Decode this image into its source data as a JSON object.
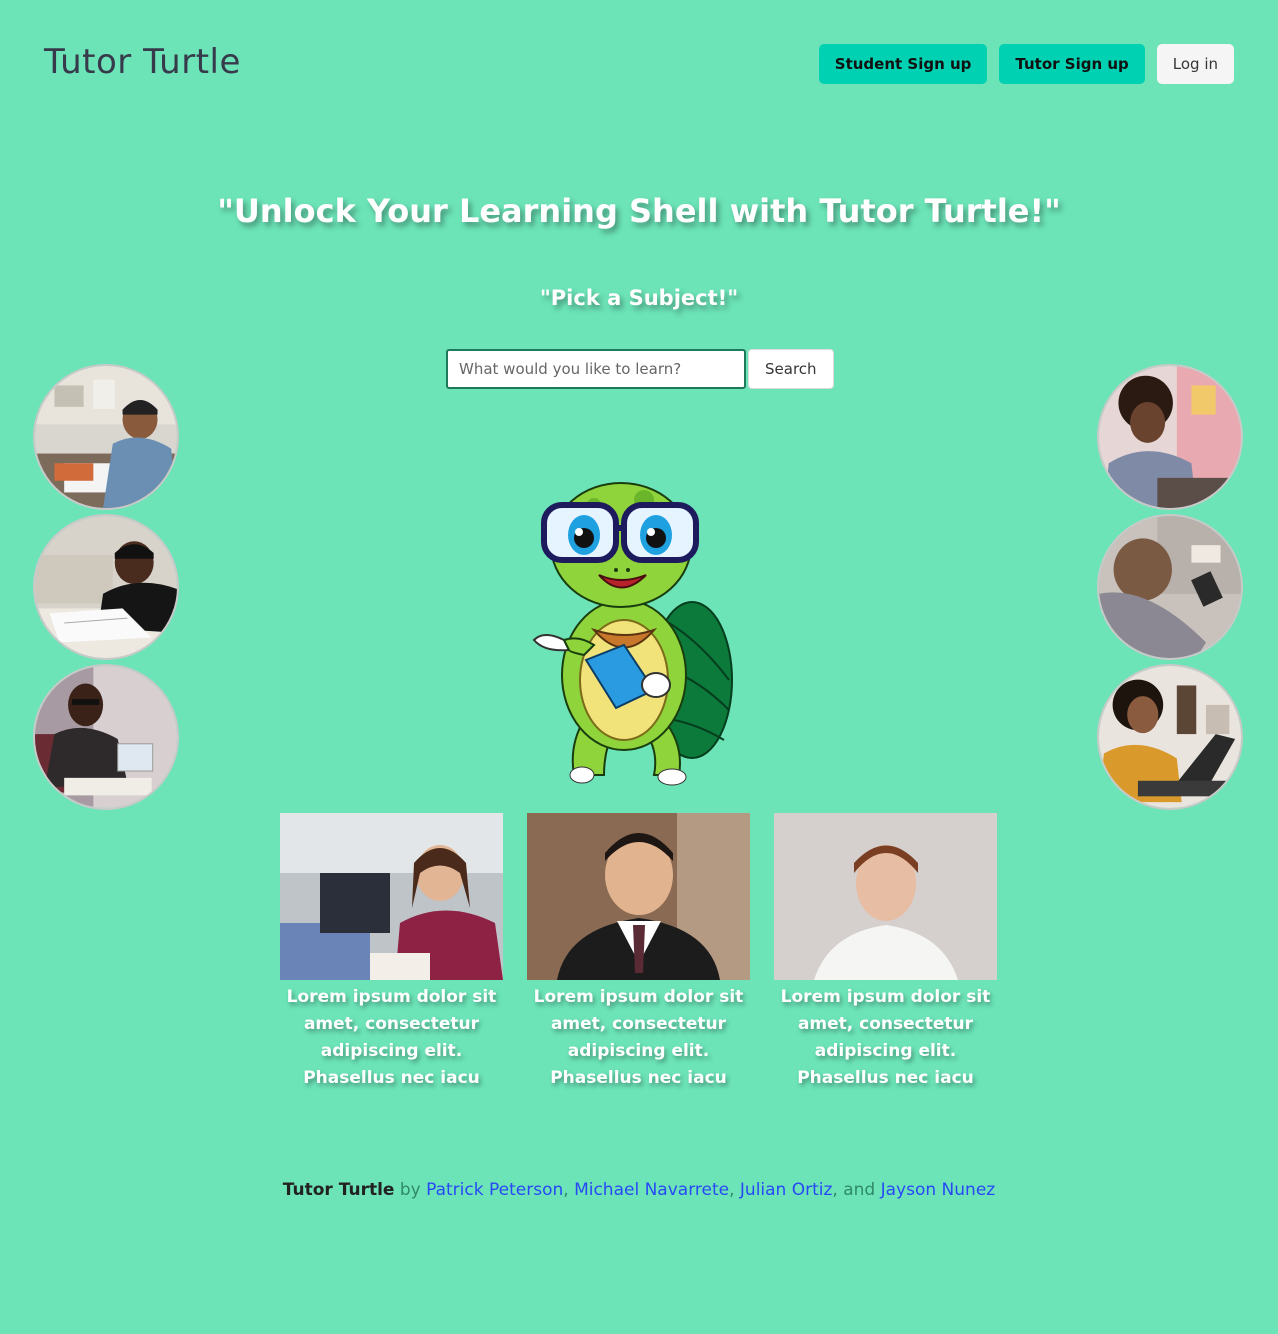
{
  "header": {
    "brand": "Tutor Turtle",
    "student_signup_label": "Student Sign up",
    "tutor_signup_label": "Tutor Sign up",
    "login_label": "Log in"
  },
  "hero": {
    "headline": "\"Unlock Your Learning Shell with Tutor Turtle!\"",
    "subhead": "\"Pick a Subject!\""
  },
  "search": {
    "placeholder": "What would you like to learn?",
    "value": "",
    "button_label": "Search"
  },
  "cards": [
    {
      "text": "Lorem ipsum dolor sit amet, consectetur adipiscing elit. Phasellus nec iacu"
    },
    {
      "text": "Lorem ipsum dolor sit amet, consectetur adipiscing elit. Phasellus nec iacu"
    },
    {
      "text": "Lorem ipsum dolor sit amet, consectetur adipiscing elit. Phasellus nec iacu"
    }
  ],
  "footer": {
    "brand": "Tutor Turtle",
    "by": " by ",
    "authors": [
      "Patrick Peterson",
      "Michael Navarrete",
      "Julian Ortiz",
      "Jayson Nunez"
    ],
    "sep": ", ",
    "and": ", and "
  },
  "colors": {
    "background": "#6ce4b8",
    "primary_button": "#00d1b2",
    "link": "#2749f5"
  }
}
